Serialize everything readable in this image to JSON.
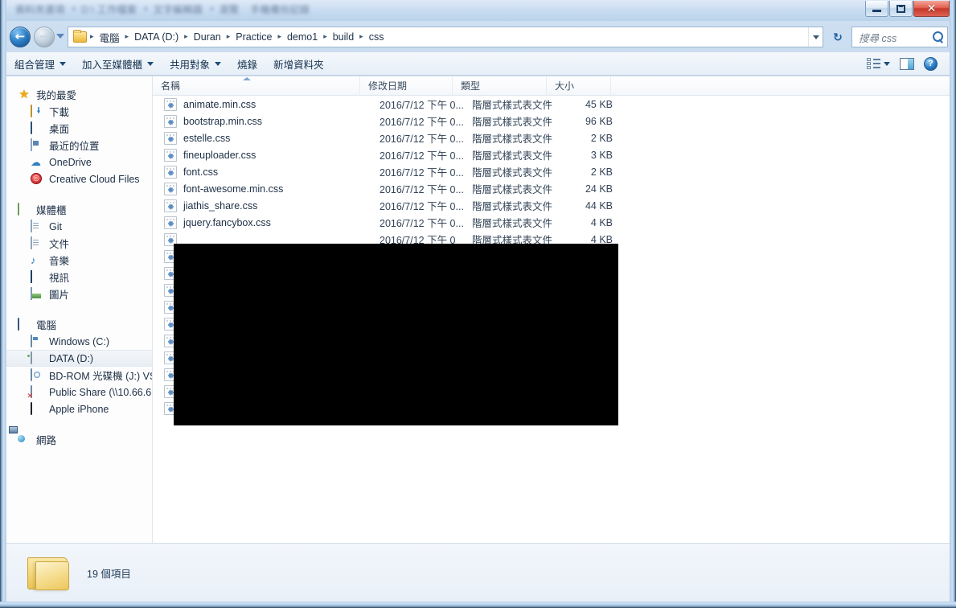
{
  "window": {
    "title_ghost_items": [
      "資料夾選項",
      "D:\\ 工作檔案",
      "文字編輯器",
      "瀏覽",
      "手機備份記錄"
    ],
    "controls": {
      "minimize": "—",
      "maximize": "❐",
      "close": "✕"
    }
  },
  "address": {
    "back_arrow": "←",
    "forward_arrow": "→",
    "refresh_icon": "↻",
    "breadcrumbs": [
      "電腦",
      "DATA (D:)",
      "Duran",
      "Practice",
      "demo1",
      "build",
      "css"
    ],
    "separator": "▸",
    "dropdown_icon": "chevron-down"
  },
  "search": {
    "placeholder": "搜尋 css",
    "value": ""
  },
  "toolbar": {
    "items": [
      {
        "label": "組合管理",
        "has_caret": true
      },
      {
        "label": "加入至媒體櫃",
        "has_caret": true
      },
      {
        "label": "共用對象",
        "has_caret": true
      },
      {
        "label": "燒錄",
        "has_caret": false
      },
      {
        "label": "新增資料夾",
        "has_caret": false
      }
    ],
    "help_glyph": "?"
  },
  "sidebar": {
    "groups": [
      {
        "header": {
          "label": "我的最愛",
          "icon": "star-icon"
        },
        "items": [
          {
            "label": "下載",
            "icon": "download-folder-icon"
          },
          {
            "label": "桌面",
            "icon": "desktop-icon"
          },
          {
            "label": "最近的位置",
            "icon": "recent-places-icon"
          },
          {
            "label": "OneDrive",
            "icon": "onedrive-icon"
          },
          {
            "label": "Creative Cloud Files",
            "icon": "creative-cloud-icon"
          }
        ]
      },
      {
        "header": {
          "label": "媒體櫃",
          "icon": "library-icon"
        },
        "items": [
          {
            "label": "Git",
            "icon": "git-folder-icon"
          },
          {
            "label": "文件",
            "icon": "documents-icon"
          },
          {
            "label": "音樂",
            "icon": "music-icon"
          },
          {
            "label": "視訊",
            "icon": "video-icon"
          },
          {
            "label": "圖片",
            "icon": "pictures-icon"
          }
        ]
      },
      {
        "header": {
          "label": "電腦",
          "icon": "computer-icon"
        },
        "items": [
          {
            "label": "Windows (C:)",
            "icon": "system-drive-icon"
          },
          {
            "label": "DATA (D:)",
            "icon": "hard-drive-icon",
            "selected": true
          },
          {
            "label": "BD-ROM 光碟機 (J:) VS.",
            "icon": "optical-drive-icon"
          },
          {
            "label": "Public Share (\\\\10.66.6",
            "icon": "network-drive-disconnected-icon"
          },
          {
            "label": "Apple iPhone",
            "icon": "phone-icon"
          }
        ]
      },
      {
        "header": {
          "label": "網路",
          "icon": "network-icon"
        },
        "items": []
      }
    ]
  },
  "filelist": {
    "columns": [
      "名稱",
      "修改日期",
      "類型",
      "大小"
    ],
    "sort": {
      "column": "名稱",
      "direction": "ascending"
    },
    "rows": [
      {
        "name": "animate.min.css",
        "date": "2016/7/12 下午 0...",
        "type": "階層式樣式表文件",
        "size": "45 KB"
      },
      {
        "name": "bootstrap.min.css",
        "date": "2016/7/12 下午 0...",
        "type": "階層式樣式表文件",
        "size": "96 KB"
      },
      {
        "name": "estelle.css",
        "date": "2016/7/12 下午 0...",
        "type": "階層式樣式表文件",
        "size": "2 KB"
      },
      {
        "name": "fineuploader.css",
        "date": "2016/7/12 下午 0...",
        "type": "階層式樣式表文件",
        "size": "3 KB"
      },
      {
        "name": "font.css",
        "date": "2016/7/12 下午 0...",
        "type": "階層式樣式表文件",
        "size": "2 KB"
      },
      {
        "name": "font-awesome.min.css",
        "date": "2016/7/12 下午 0...",
        "type": "階層式樣式表文件",
        "size": "24 KB"
      },
      {
        "name": "jiathis_share.css",
        "date": "2016/7/12 下午 0...",
        "type": "階層式樣式表文件",
        "size": "44 KB"
      },
      {
        "name": "jquery.fancybox.css",
        "date": "2016/7/12 下午 0...",
        "type": "階層式樣式表文件",
        "size": "4 KB"
      },
      {
        "name": "",
        "date": "2016/7/12 下午 0",
        "type": "階層式樣式表文件",
        "size": "4 KB"
      },
      {
        "name": "",
        "date": "",
        "type": "",
        "size": ""
      },
      {
        "name": "",
        "date": "",
        "type": "",
        "size": ""
      },
      {
        "name": "",
        "date": "",
        "type": "",
        "size": ""
      },
      {
        "name": "",
        "date": "",
        "type": "",
        "size": ""
      },
      {
        "name": "",
        "date": "",
        "type": "",
        "size": ""
      },
      {
        "name": "",
        "date": "",
        "type": "",
        "size": ""
      },
      {
        "name": "",
        "date": "",
        "type": "",
        "size": ""
      },
      {
        "name": "",
        "date": "",
        "type": "",
        "size": ""
      },
      {
        "name": "",
        "date": "",
        "type": "",
        "size": ""
      },
      {
        "name": "",
        "date": "",
        "type": "",
        "size": ""
      }
    ]
  },
  "statusbar": {
    "item_count": "19 個項目"
  },
  "colors": {
    "accent": "#2f7fc0",
    "close_button": "#c5392a",
    "selection": "#e9eef4",
    "text": "#1c2e44",
    "blackout": "#000000"
  }
}
